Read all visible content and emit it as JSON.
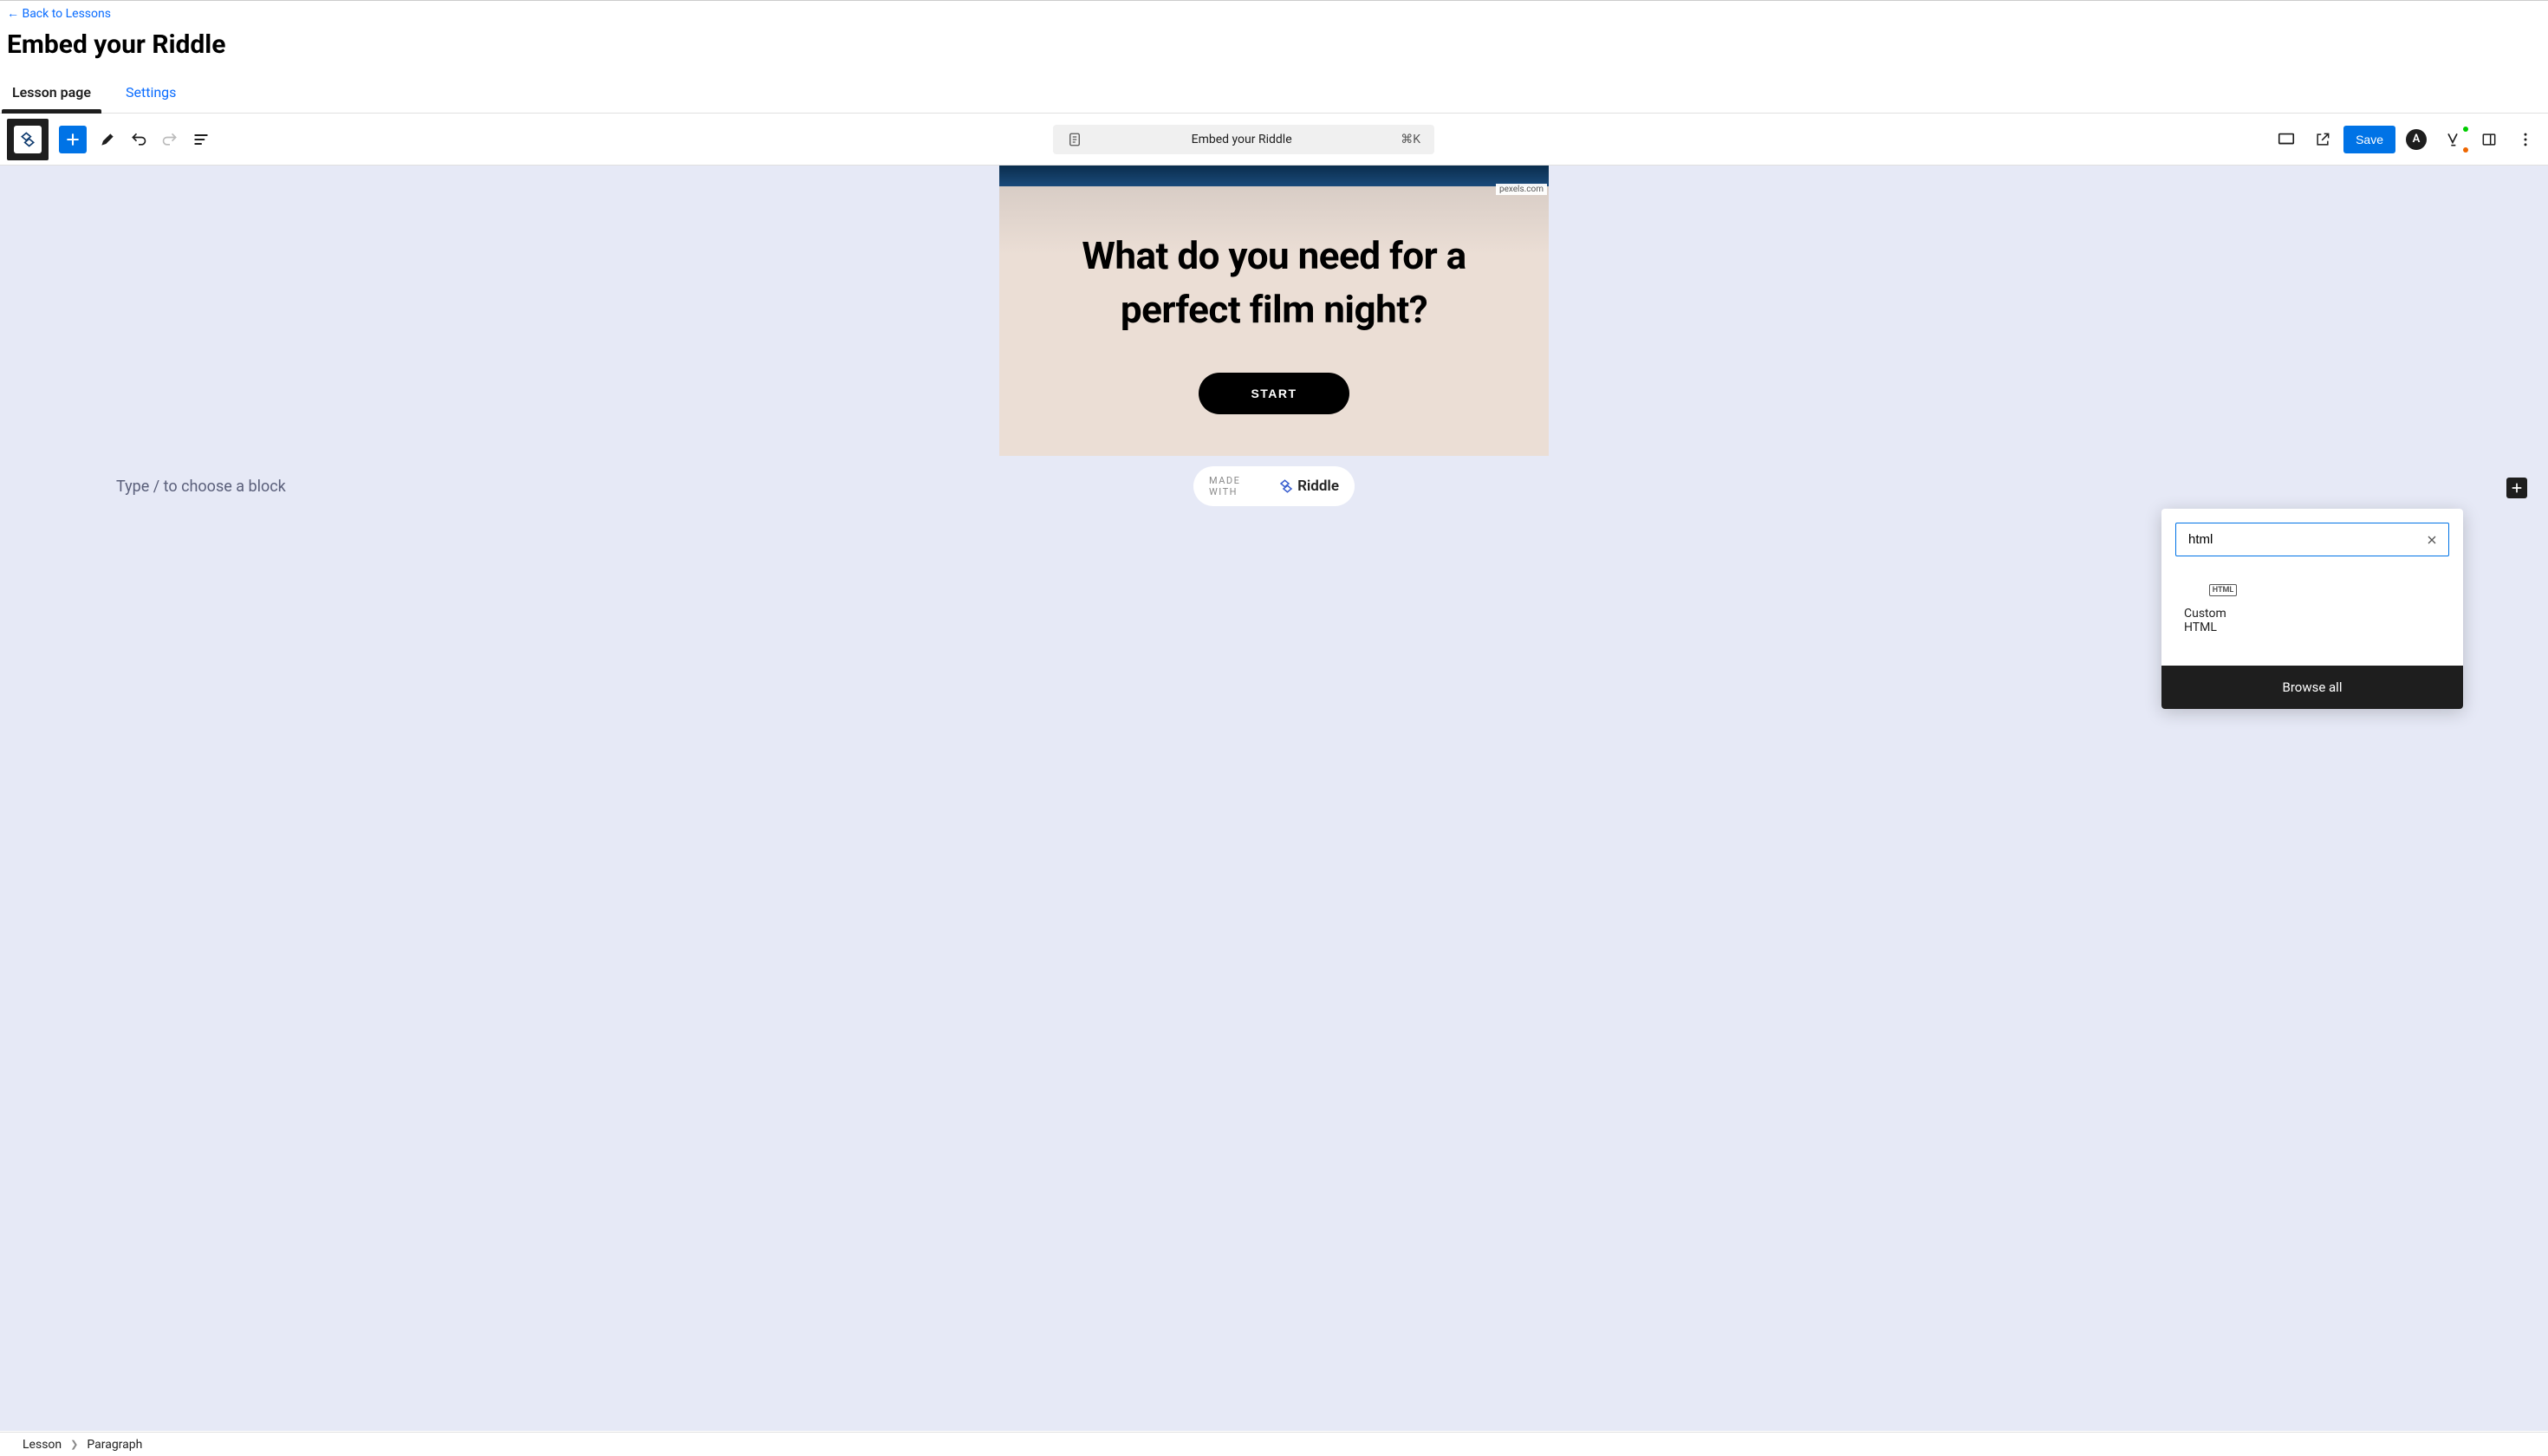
{
  "header": {
    "back_link": "← Back to Lessons",
    "page_title": "Embed your Riddle"
  },
  "page_tabs": {
    "active": "Lesson page",
    "inactive": "Settings"
  },
  "toolbar": {
    "doc_title": "Embed your Riddle",
    "shortcut": "⌘K",
    "save_label": "Save",
    "avatar_initial": "A"
  },
  "riddle": {
    "img_credit": "pexels.com",
    "question": "What do you need for a perfect film night?",
    "start_label": "START",
    "madewith_prefix": "MADE WITH",
    "brand": "Riddle"
  },
  "editor": {
    "placeholder": "Type / to choose a block"
  },
  "block_inserter": {
    "search_value": "html",
    "results": [
      {
        "icon_label": "HTML",
        "label": "Custom HTML"
      }
    ],
    "browse_all": "Browse all"
  },
  "breadcrumb": {
    "root": "Lesson",
    "current": "Paragraph"
  }
}
